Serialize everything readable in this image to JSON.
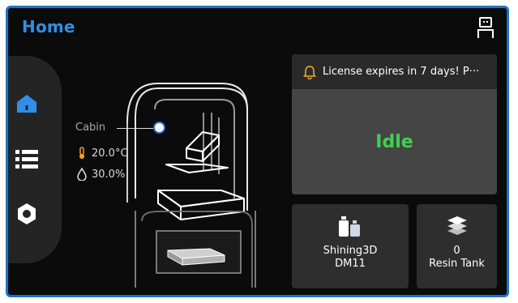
{
  "header": {
    "title": "Home"
  },
  "sidebar": {
    "items": [
      {
        "name": "home",
        "icon": "home-icon",
        "active": true
      },
      {
        "name": "list",
        "icon": "list-icon",
        "active": false
      },
      {
        "name": "settings",
        "icon": "gear-icon",
        "active": false
      }
    ]
  },
  "cabin": {
    "label": "Cabin",
    "temperature": "20.0°C",
    "humidity": "30.0%"
  },
  "notice": {
    "text": "License expires in 7 days! P···",
    "icon": "bell-icon"
  },
  "status": {
    "text": "Idle"
  },
  "cards": [
    {
      "line1": "Shining3D",
      "line2": "DM11",
      "icon": "resin-bottles-icon"
    },
    {
      "line1": "0",
      "line2": "Resin Tank",
      "icon": "layers-icon"
    }
  ],
  "colors": {
    "accent": "#2f8fe8",
    "status_idle": "#3ed14f",
    "alert": "#f0a428"
  }
}
